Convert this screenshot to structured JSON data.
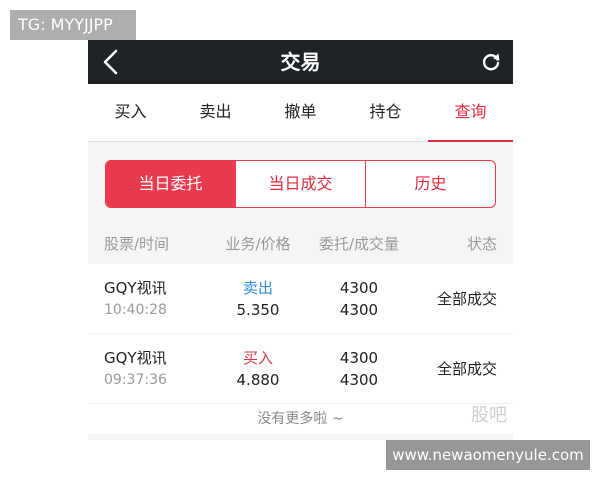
{
  "overlay_tag": "TG: MYYJJPP",
  "overlay_url": "www.newaomenyule.com",
  "header": {
    "title": "交易"
  },
  "tabs": [
    {
      "label": "买入",
      "active": false
    },
    {
      "label": "卖出",
      "active": false
    },
    {
      "label": "撤单",
      "active": false
    },
    {
      "label": "持仓",
      "active": false
    },
    {
      "label": "查询",
      "active": true
    }
  ],
  "segments": [
    {
      "label": "当日委托",
      "active": true
    },
    {
      "label": "当日成交",
      "active": false
    },
    {
      "label": "历史",
      "active": false
    }
  ],
  "columns": [
    "股票/时间",
    "业务/价格",
    "委托/成交量",
    "状态"
  ],
  "rows": [
    {
      "name": "GQY视讯",
      "time": "10:40:28",
      "op": "卖出",
      "price": "5.350",
      "order_qty": "4300",
      "deal_qty": "4300",
      "status": "全部成交"
    },
    {
      "name": "GQY视讯",
      "time": "09:37:36",
      "op": "买入",
      "price": "4.880",
      "order_qty": "4300",
      "deal_qty": "4300",
      "status": "全部成交"
    }
  ],
  "footer": {
    "text": "没有更多啦 ~",
    "watermark": "股吧"
  },
  "colors": {
    "accent": "#e02a3e",
    "sell": "#2e8fd6",
    "buy": "#d23a4c",
    "topbar": "#1f2326"
  }
}
